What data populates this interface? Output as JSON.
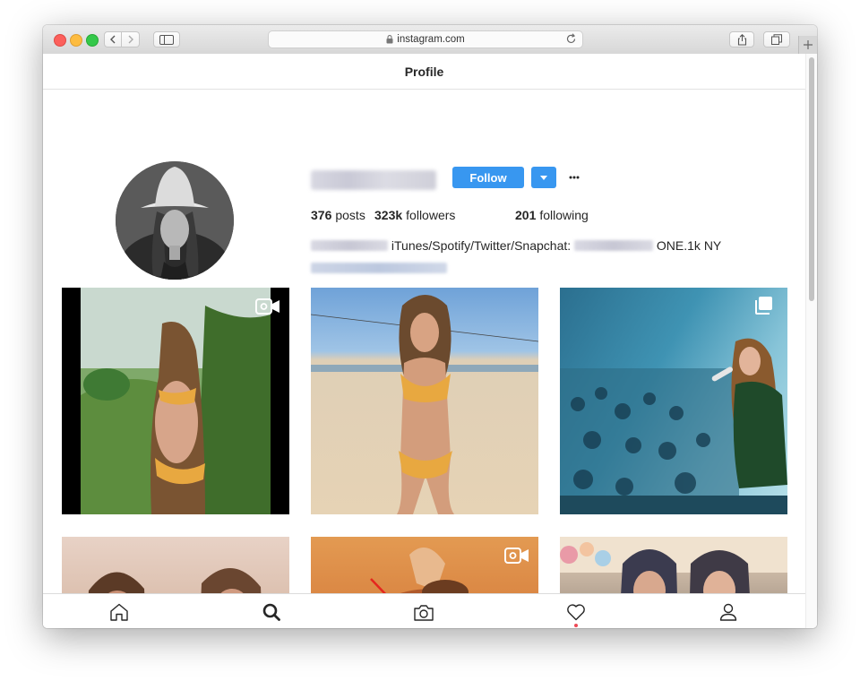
{
  "browser": {
    "url": "instagram.com",
    "icons": [
      "back-icon",
      "forward-icon",
      "sidebar-icon",
      "lock-icon",
      "reload-icon",
      "share-icon",
      "tabs-icon",
      "plus-icon"
    ]
  },
  "header": {
    "title": "Profile"
  },
  "profile": {
    "follow_label": "Follow",
    "stats": {
      "posts_count": "376",
      "posts_label": "posts",
      "followers_count": "323k",
      "followers_label": "followers",
      "following_count": "201",
      "following_label": "following"
    },
    "bio_text": "iTunes/Spotify/Twitter/Snapchat:",
    "bio_suffix": "ONE.1k NY"
  },
  "nav": {
    "items": [
      "home-icon",
      "search-icon",
      "camera-icon",
      "heart-icon",
      "user-icon"
    ],
    "active": "search"
  },
  "colors": {
    "accent": "#3897f0",
    "notification": "#ed4956",
    "annotation_arrow": "#e5261e"
  }
}
